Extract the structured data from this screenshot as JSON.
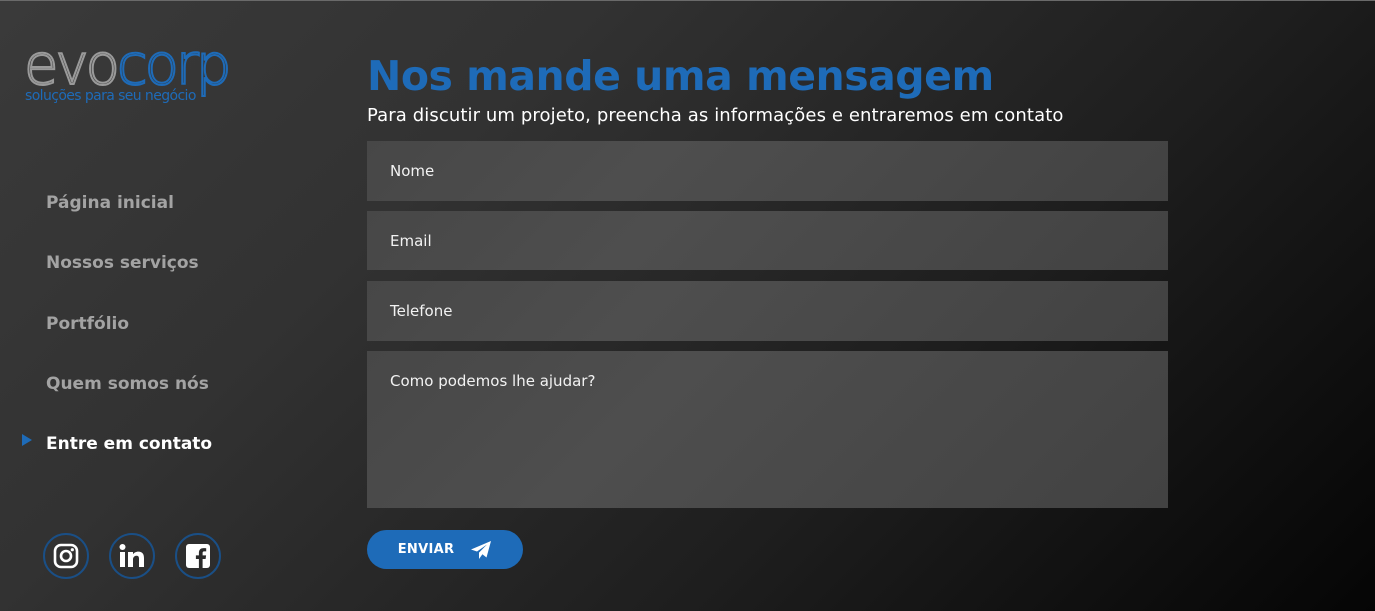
{
  "brand": {
    "logo_part1": "evo",
    "logo_part2": "corp",
    "tagline": "soluções para seu negócio",
    "accent_color": "#1e6bb8"
  },
  "nav": {
    "items": [
      {
        "label": "Página inicial",
        "active": false
      },
      {
        "label": "Nossos serviços",
        "active": false
      },
      {
        "label": "Portfólio",
        "active": false
      },
      {
        "label": "Quem somos nós",
        "active": false
      },
      {
        "label": "Entre em contato",
        "active": true
      }
    ]
  },
  "socials": [
    "instagram-icon",
    "linkedin-icon",
    "facebook-icon"
  ],
  "contact": {
    "title": "Nos mande uma mensagem",
    "subtitle": "Para discutir um projeto, preencha as informações e entraremos em contato",
    "fields": {
      "nome": "Nome",
      "email": "Email",
      "telefone": "Telefone",
      "mensagem": "Como podemos lhe ajudar?"
    },
    "submit_label": "ENVIAR",
    "submit_icon": "paper-plane-icon"
  }
}
